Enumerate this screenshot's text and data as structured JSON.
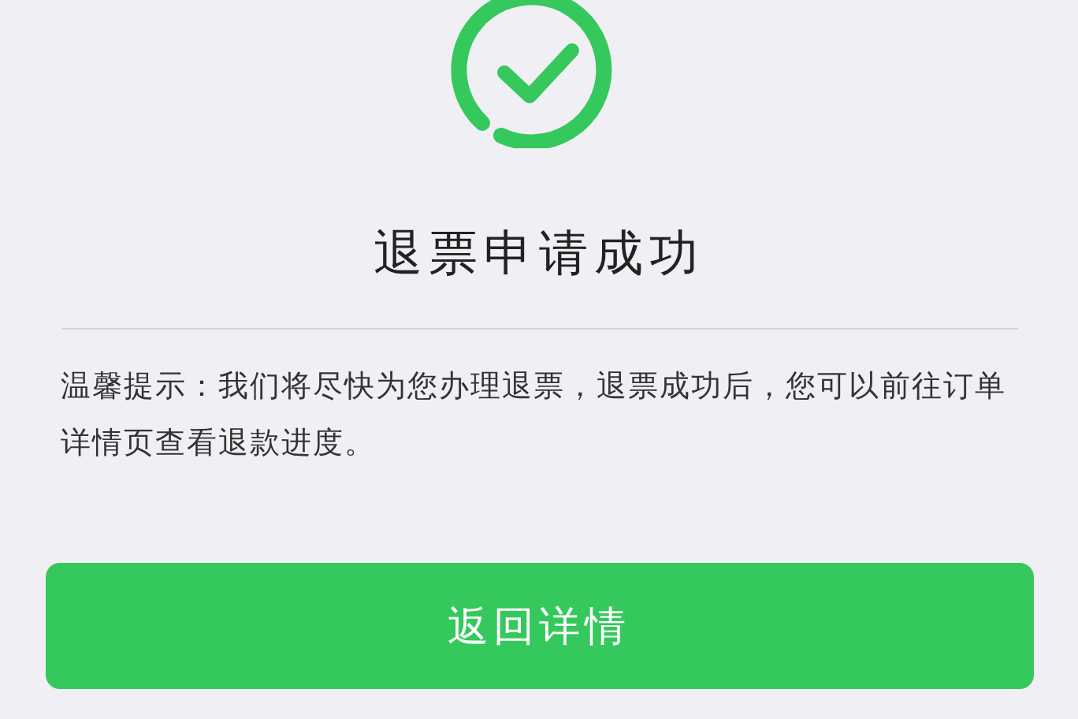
{
  "title": "退票申请成功",
  "notice": "温馨提示：我们将尽快为您办理退票，退票成功后，您可以前往订单详情页查看退款进度。",
  "buttons": [
    {
      "label": "返回详情"
    }
  ]
}
